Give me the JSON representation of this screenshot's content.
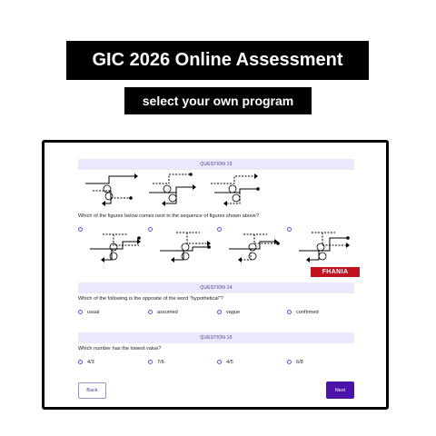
{
  "header": {
    "title": "GIC 2026 Online Assessment",
    "subtitle": "select your own program"
  },
  "questions": [
    {
      "heading": "QUESTION 13",
      "text": "Which of the figures below comes next in the sequence of figures shown above?",
      "options": [
        "",
        "",
        "",
        ""
      ]
    },
    {
      "heading": "QUESTION 14",
      "text": "Which of the following is the opposite of the word \"hypothetical\"?",
      "options": [
        "usual",
        "assumed",
        "vague",
        "confirmed"
      ]
    },
    {
      "heading": "QUESTION 15",
      "text": "Which number has the lowest value?",
      "options": [
        "4/3",
        "7/6",
        "4/5",
        "6/8"
      ]
    }
  ],
  "brand": {
    "label": "FHANIA",
    "color": "#c1121f"
  },
  "nav": {
    "back_label": "Back",
    "next_label": "Next"
  },
  "colors": {
    "accent": "#4b14a8",
    "question_bar": "#ede7fb",
    "radio": "#6c4de0"
  },
  "icons": {
    "radio": "radio-circle-icon",
    "sequence_figure": "path-diagram-icon"
  }
}
